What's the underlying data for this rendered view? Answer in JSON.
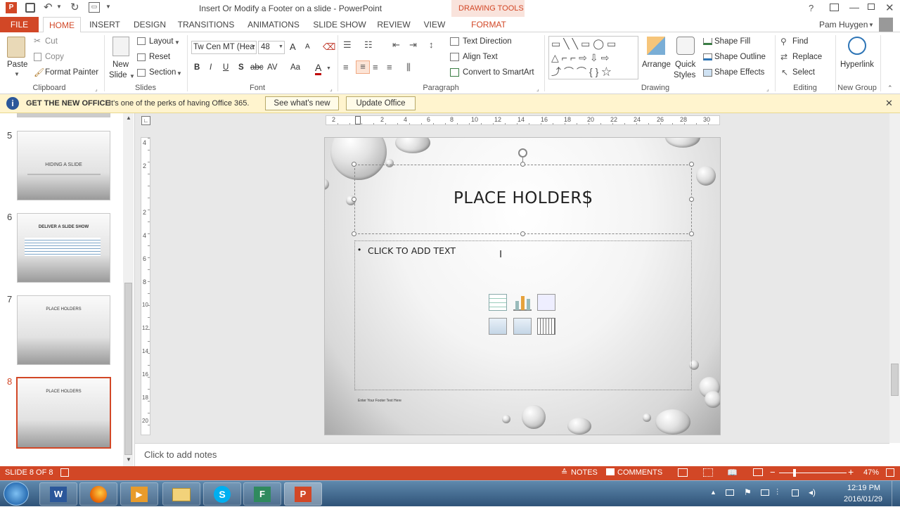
{
  "window": {
    "title": "Insert Or Modify a Footer on a slide - PowerPoint",
    "contextual_group": "DRAWING TOOLS",
    "help": "?",
    "user": "Pam Huygen"
  },
  "tabs": [
    "FILE",
    "HOME",
    "INSERT",
    "DESIGN",
    "TRANSITIONS",
    "ANIMATIONS",
    "SLIDE SHOW",
    "REVIEW",
    "VIEW",
    "FORMAT"
  ],
  "ribbon": {
    "clipboard": {
      "paste": "Paste",
      "cut": "Cut",
      "copy": "Copy",
      "format_painter": "Format Painter",
      "label": "Clipboard"
    },
    "slides": {
      "new_slide_1": "New",
      "new_slide_2": "Slide",
      "layout": "Layout",
      "reset": "Reset",
      "section": "Section",
      "label": "Slides"
    },
    "font": {
      "name": "Tw Cen MT (Hea",
      "size": "48",
      "bold": "B",
      "italic": "I",
      "underline": "U",
      "shadow": "S",
      "strike": "abc",
      "spacing": "AV",
      "case": "Aa",
      "color": "A",
      "grow": "A",
      "shrink": "A",
      "label": "Font"
    },
    "paragraph": {
      "text_direction": "Text Direction",
      "align_text": "Align Text",
      "convert_smartart": "Convert to SmartArt",
      "label": "Paragraph"
    },
    "drawing": {
      "arrange": "Arrange",
      "quick_styles_1": "Quick",
      "quick_styles_2": "Styles",
      "shape_fill": "Shape Fill",
      "shape_outline": "Shape Outline",
      "shape_effects": "Shape Effects",
      "label": "Drawing"
    },
    "editing": {
      "find": "Find",
      "replace": "Replace",
      "select": "Select",
      "label": "Editing"
    },
    "new_group": {
      "hyperlink": "Hyperlink",
      "label": "New Group"
    }
  },
  "infobar": {
    "title": "GET THE NEW OFFICE",
    "message": "It's one of the perks of having Office 365.",
    "see_whats_new": "See what's new",
    "update_office": "Update Office"
  },
  "thumbnails": [
    {
      "num": "5",
      "title": "HIDING A SLIDE"
    },
    {
      "num": "6",
      "title": "DELIVER A SLIDE SHOW"
    },
    {
      "num": "7",
      "title": "PLACE HOLDERS"
    },
    {
      "num": "8",
      "title": "PLACE HOLDERS"
    }
  ],
  "ruler": [
    "2",
    "2",
    "4",
    "6",
    "8",
    "10",
    "12",
    "14",
    "16",
    "18",
    "20",
    "22",
    "24",
    "26",
    "28",
    "30"
  ],
  "vruler": [
    "4",
    "2",
    "2",
    "4",
    "6",
    "8",
    "10",
    "12",
    "14",
    "16",
    "18",
    "20"
  ],
  "slide": {
    "title": "PLACE HOLDERS",
    "bullet": "CLICK TO ADD TEXT",
    "footer": "Enter Your Footer Text Here"
  },
  "notes": {
    "placeholder": "Click to add notes"
  },
  "status": {
    "slide_info": "SLIDE 8 OF 8",
    "notes": "NOTES",
    "comments": "COMMENTS",
    "zoom": "47%",
    "zoom_fraction": 0.47
  },
  "taskbar": {
    "time": "12:19 PM",
    "date": "2016/01/29",
    "apps": [
      "start-orb",
      "word",
      "firefox",
      "media-player",
      "file-explorer",
      "skype",
      "app-f",
      "powerpoint"
    ]
  },
  "colors": {
    "accent": "#d24726",
    "infobar": "#fff4ce",
    "taskbar": "#3b6088"
  }
}
